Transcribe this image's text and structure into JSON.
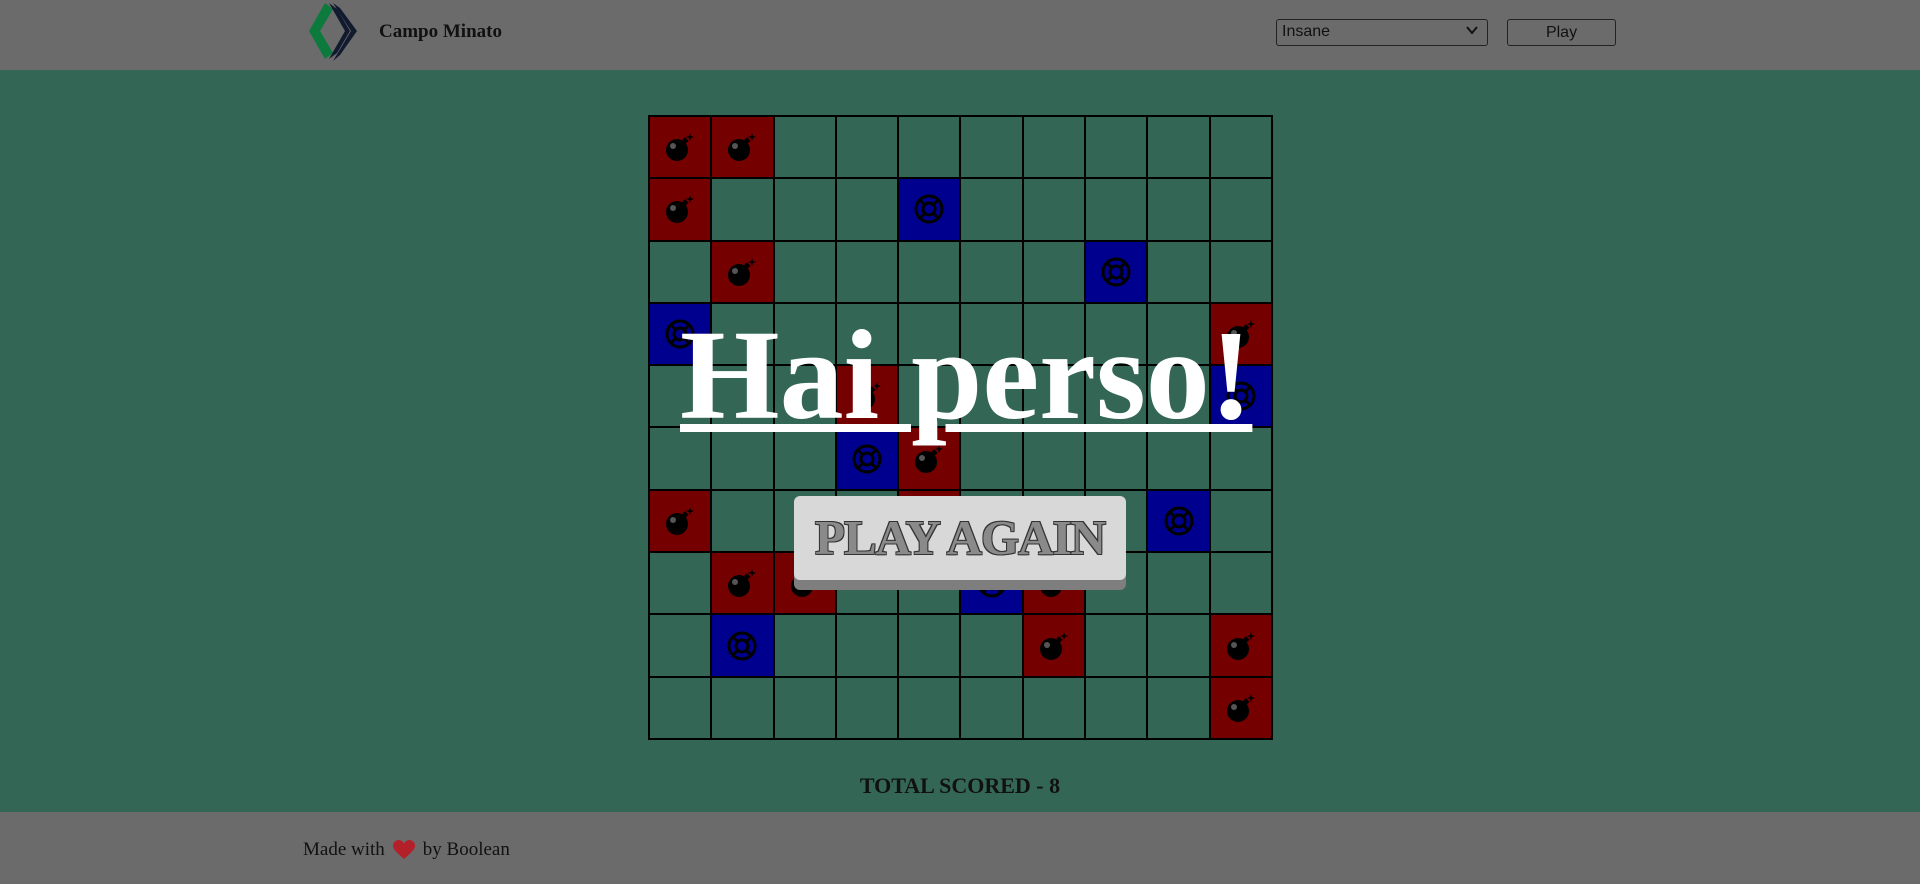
{
  "header": {
    "brand": "Campo Minato",
    "difficulty": "Insane",
    "play_label": "Play",
    "colors": {
      "bar": "#6b6b6b",
      "logo_green": "#0b7a3c",
      "logo_navy": "#111a2e"
    }
  },
  "board": {
    "rows": 10,
    "cols": 10,
    "colors": {
      "bomb": "#740000",
      "safe": "#00008e",
      "empty": "#346656"
    },
    "legend": {
      "B": "bomb",
      "S": "safe-revealed",
      ".": "empty"
    },
    "cells": [
      "BB........",
      "B...S.....",
      ".B.....S..",
      "S........B",
      "...B.....S",
      "...SB.....",
      "B...B...S.",
      ".BB..SB...",
      ".S....B..B",
      ".........B"
    ]
  },
  "overlay": {
    "title": "Hai perso!",
    "play_again_label": "PLAY AGAIN"
  },
  "score": {
    "text": "TOTAL SCORED - 8"
  },
  "footer": {
    "made_with": "Made with",
    "by": "by Boolean",
    "heart_icon": "heart-icon"
  }
}
